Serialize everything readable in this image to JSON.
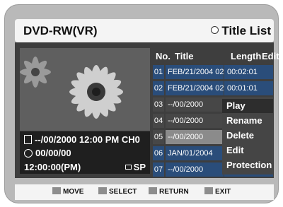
{
  "header": {
    "title": "DVD-RW(VR)",
    "view": "Title List"
  },
  "columns": {
    "no": "No.",
    "title": "Title",
    "length": "Length",
    "edit": "Edit"
  },
  "rows": [
    {
      "no": "01",
      "title": "FEB/21/2004 02",
      "length": "00:02:01"
    },
    {
      "no": "02",
      "title": "FEB/21/2004 02",
      "length": "00:01:01"
    },
    {
      "no": "03",
      "title": "--/00/2000",
      "length": ""
    },
    {
      "no": "04",
      "title": "--/00/2000",
      "length": ""
    },
    {
      "no": "05",
      "title": "--/00/2000",
      "length": ""
    },
    {
      "no": "06",
      "title": "JAN/01/2004",
      "length": ""
    },
    {
      "no": "07",
      "title": "--/00/2000",
      "length": ""
    }
  ],
  "menu": [
    "Play",
    "Rename",
    "Delete",
    "Edit",
    "Protection"
  ],
  "info": {
    "date_line": "--/00/2000 12:00 PM CH0",
    "date2": "00/00/00",
    "time": "12:00:00(PM)",
    "mode": "SP"
  },
  "footer": {
    "move": "MOVE",
    "select": "SELECT",
    "return": "RETURN",
    "exit": "EXIT"
  }
}
